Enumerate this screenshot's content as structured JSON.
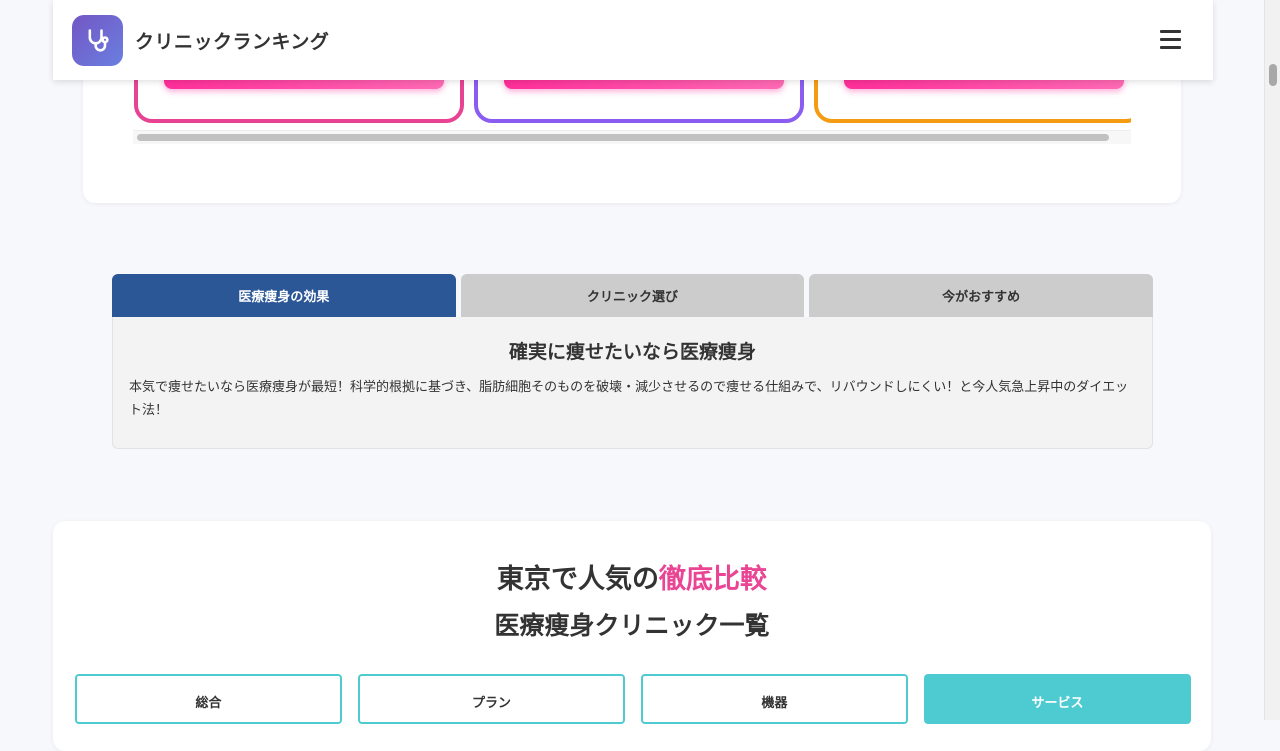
{
  "header": {
    "site_title": "クリニックランキング",
    "logo_icon": "stethoscope-icon",
    "menu_icon": "hamburger-menu-icon"
  },
  "top_cards": {
    "border_colors": [
      "#e84393",
      "#8a5cf0",
      "#f39c12"
    ]
  },
  "tabs": {
    "items": [
      {
        "label": "医療痩身の効果",
        "active": true
      },
      {
        "label": "クリニック選び",
        "active": false
      },
      {
        "label": "今がおすすめ",
        "active": false
      }
    ],
    "panel": {
      "title": "確実に痩せたいなら医療痩身",
      "text": "本気で痩せたいなら医療痩身が最短！科学的根拠に基づき、脂肪細胞そのものを破壊・減少させるので痩せる仕組みで、リバウンドしにくい！と今人気急上昇中のダイエット法！"
    }
  },
  "compare": {
    "title_prefix": "東京で人気の",
    "title_accent": "徹底比較",
    "subtitle": "医療痩身クリニック一覧",
    "filters": [
      {
        "label": "総合",
        "active": false
      },
      {
        "label": "プラン",
        "active": false
      },
      {
        "label": "機器",
        "active": false
      },
      {
        "label": "サービス",
        "active": true
      }
    ]
  },
  "colors": {
    "tab_active": "#2c5797",
    "accent_pink": "#e94594",
    "filter_teal": "#4ecbd1"
  }
}
